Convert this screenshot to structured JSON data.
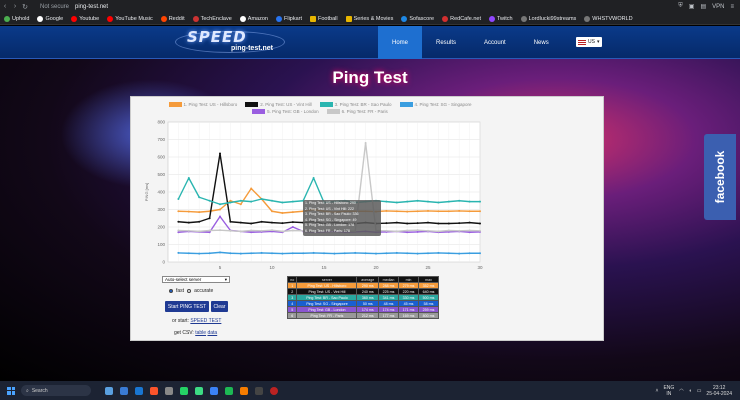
{
  "browser": {
    "security_label": "Not secure",
    "url": "ping-test.net",
    "vpn_label": "VPN",
    "bookmarks": [
      "Uphold",
      "Google",
      "Youtube",
      "YouTube Music",
      "Reddit",
      "TechEnclave",
      "Amazon",
      "Flipkart",
      "Football",
      "Series & Movies",
      "Sofascore",
      "RedCafe.net",
      "Twitch",
      "Lordlucki99streams",
      "WHSTVWORLD"
    ]
  },
  "site": {
    "logo_big": "SPEED",
    "logo_small": "ping-test.net",
    "nav": [
      "Home",
      "Results",
      "Account",
      "News"
    ],
    "lang": "US",
    "page_title": "Ping Test",
    "facebook": "facebook"
  },
  "chart_data": {
    "type": "line",
    "title": "",
    "xlabel": "",
    "ylabel": "PING [ms]",
    "xlim": [
      0,
      30
    ],
    "ylim": [
      0,
      800
    ],
    "xticks": [
      5,
      10,
      15,
      20,
      25,
      30
    ],
    "yticks": [
      0,
      100,
      200,
      300,
      400,
      500,
      600,
      700,
      800
    ],
    "grid": true,
    "legend_position": "top",
    "series": [
      {
        "name": "1. Ping Test: US - Hillsboro",
        "color": "#f59b3b",
        "values": [
          290,
          288,
          285,
          290,
          300,
          350,
          330,
          420,
          360,
          290,
          280,
          285,
          290,
          300,
          290,
          285,
          290,
          290,
          290,
          288,
          292,
          290,
          288,
          290,
          292,
          290,
          290,
          292,
          290,
          290
        ]
      },
      {
        "name": "2. Ping Test: US - Vint Hill",
        "color": "#111111",
        "values": [
          230,
          225,
          230,
          250,
          620,
          230,
          225,
          220,
          230,
          225,
          222,
          228,
          225,
          230,
          220,
          225,
          222,
          220,
          225,
          220,
          222,
          225,
          220,
          222,
          225,
          220,
          220,
          222,
          225,
          220
        ]
      },
      {
        "name": "3. Ping Test: BR - Sao Paulo",
        "color": "#2ab5b0",
        "values": [
          360,
          480,
          370,
          350,
          330,
          340,
          350,
          345,
          360,
          350,
          340,
          345,
          350,
          480,
          340,
          345,
          350,
          340,
          345,
          350,
          345,
          340,
          345,
          350,
          345,
          340,
          345,
          350,
          345,
          345
        ]
      },
      {
        "name": "4. Ping Test: SG - Singapore",
        "color": "#3a9ee0",
        "values": [
          52,
          50,
          48,
          50,
          55,
          50,
          48,
          50,
          52,
          50,
          48,
          50,
          50,
          52,
          50,
          48,
          50,
          52,
          50,
          48,
          50,
          52,
          50,
          48,
          50,
          52,
          50,
          48,
          50,
          50
        ]
      },
      {
        "name": "5. Ping Test: GB - London",
        "color": "#9a5ee0",
        "values": [
          170,
          175,
          172,
          170,
          260,
          180,
          175,
          170,
          172,
          175,
          170,
          200,
          175,
          170,
          172,
          175,
          170,
          172,
          175,
          170,
          172,
          175,
          170,
          172,
          175,
          170,
          172,
          175,
          170,
          172
        ]
      },
      {
        "name": "6. Ping Test: FR - Paris",
        "color": "#c8c8c8",
        "values": [
          180,
          178,
          175,
          180,
          182,
          178,
          175,
          180,
          178,
          182,
          175,
          180,
          178,
          175,
          180,
          182,
          178,
          175,
          680,
          180,
          178,
          175,
          180,
          182,
          178,
          175,
          180,
          178,
          180,
          178
        ]
      }
    ]
  },
  "tooltip": [
    "1. Ping Test: US - Hillsboro: 290",
    "2. Ping Test: US - Vint Hill: 222",
    "3. Ping Test: BR - Sao Paulo: 336",
    "4. Ping Test: SG - Singapore: 49",
    "5. Ping Test: GB - London: 178",
    "6. Ping Test: FR - Paris: 178"
  ],
  "controls": {
    "server_select": "Auto-select server",
    "radio_fast": "fast",
    "radio_accurate": "accurate",
    "start_button": "Start PING TEST",
    "clear_button": "Clear",
    "start_prefix": "or start:",
    "start_link": "SPEED TEST",
    "csv_prefix": "get CSV:",
    "csv_table": "table",
    "csv_data": "data"
  },
  "results_table": {
    "headers": [
      "no",
      "server",
      "average",
      "median",
      "min",
      "max"
    ],
    "rows": [
      [
        "1",
        "Ping Test: US - Hillsboro",
        "290 ms",
        "288 ms",
        "279 ms",
        "352 ms"
      ],
      [
        "2",
        "Ping Test: US - Vint Hill",
        "240 ms",
        "225 ms",
        "220 ms",
        "640 ms"
      ],
      [
        "3",
        "Ping Test: BR - Sao Paulo",
        "360 ms",
        "341 ms",
        "330 ms",
        "500 ms"
      ],
      [
        "4",
        "Ping Test: SG - Singapore",
        "50 ms",
        "48 ms",
        "45 ms",
        "58 ms"
      ],
      [
        "5",
        "Ping Test: GB - London",
        "174 ms",
        "174 ms",
        "171 ms",
        "259 ms"
      ],
      [
        "6",
        "Ping Test: FR - Paris",
        "212 ms",
        "177 ms",
        "169 ms",
        "800 ms"
      ]
    ]
  },
  "taskbar": {
    "search": "Search",
    "lang": "ENG",
    "region": "IN",
    "time": "23:12",
    "date": "25-04-2024"
  }
}
